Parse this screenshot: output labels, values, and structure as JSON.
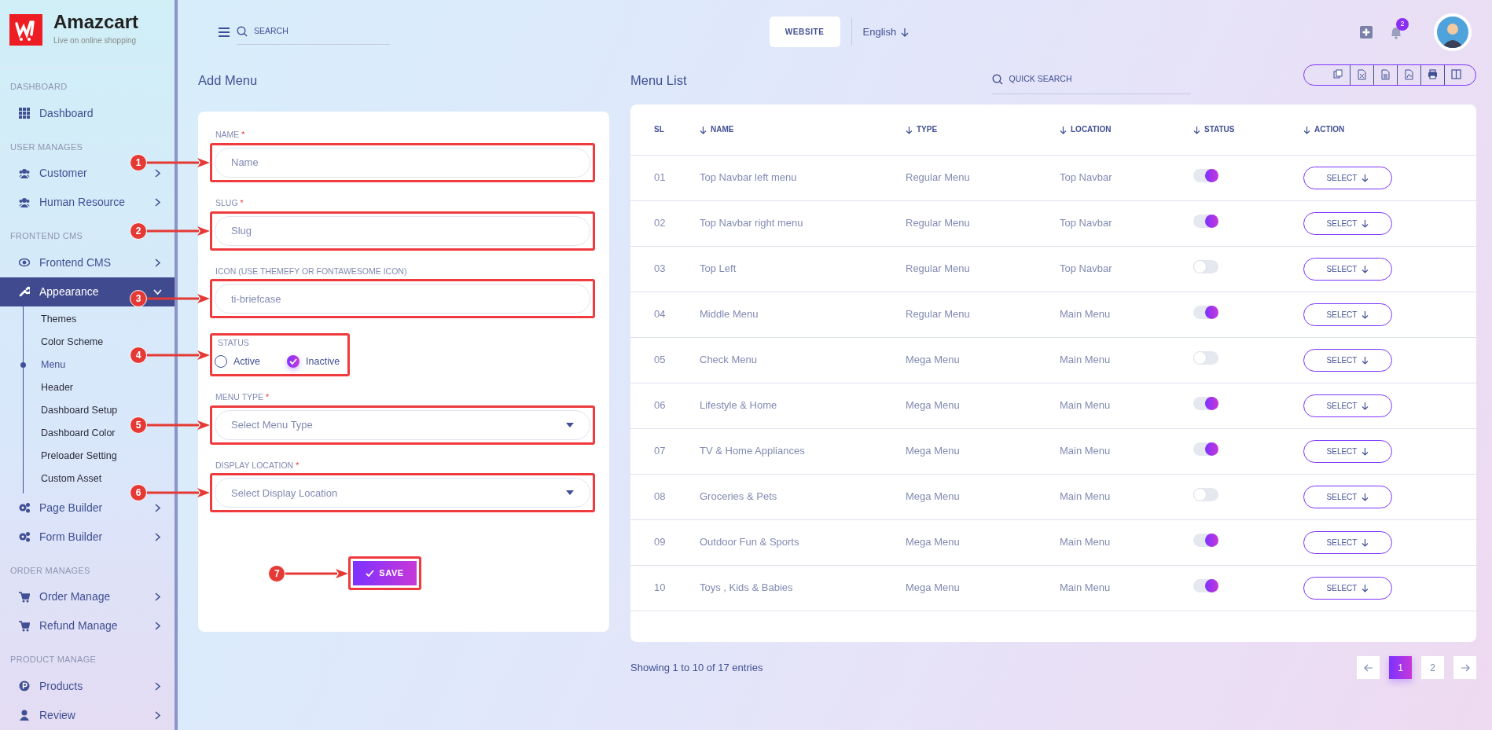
{
  "brand": {
    "name": "Amazcart",
    "tagline": "Live on online shopping"
  },
  "sidebar": [
    {
      "heading": "DASHBOARD",
      "items": [
        {
          "label": "Dashboard",
          "selected": false
        }
      ]
    },
    {
      "heading": "USER MANAGES",
      "items": [
        {
          "label": "Customer",
          "expanded": false,
          "selected": false
        },
        {
          "label": "Human Resource",
          "expanded": false,
          "selected": false
        }
      ]
    },
    {
      "heading": "FRONTEND CMS",
      "items": [
        {
          "label": "Frontend CMS",
          "expanded": false,
          "selected": false
        },
        {
          "label": "Appearance",
          "expanded": true,
          "selected": true,
          "children": [
            {
              "label": "Themes",
              "selected": false
            },
            {
              "label": "Color Scheme",
              "selected": false
            },
            {
              "label": "Menu",
              "selected": true
            },
            {
              "label": "Header",
              "selected": false
            },
            {
              "label": "Dashboard Setup",
              "selected": false
            },
            {
              "label": "Dashboard Color",
              "selected": false
            },
            {
              "label": "Preloader Setting",
              "selected": false
            },
            {
              "label": "Custom Asset",
              "selected": false
            }
          ]
        },
        {
          "label": "Page Builder",
          "expanded": false,
          "selected": false
        },
        {
          "label": "Form Builder",
          "expanded": false,
          "selected": false
        }
      ]
    },
    {
      "heading": "ORDER MANAGES",
      "items": [
        {
          "label": "Order Manage",
          "expanded": false,
          "selected": false
        },
        {
          "label": "Refund Manage",
          "expanded": false,
          "selected": false
        }
      ]
    },
    {
      "heading": "PRODUCT MANAGE",
      "items": [
        {
          "label": "Products",
          "expanded": false,
          "selected": false
        },
        {
          "label": "Review",
          "expanded": false,
          "selected": false
        }
      ]
    }
  ],
  "topbar": {
    "search_placeholder": "SEARCH",
    "website_button": "WEBSITE",
    "language": "English",
    "notification_count": "2"
  },
  "add_menu": {
    "title": "Add Menu",
    "fields": [
      {
        "kind": "text",
        "label": "NAME",
        "required_mark": "*",
        "placeholder": "Name",
        "highlighted": true,
        "callout": "1"
      },
      {
        "kind": "text",
        "label": "SLUG",
        "required_mark": "*",
        "placeholder": "Slug",
        "highlighted": true,
        "callout": "2"
      },
      {
        "kind": "text",
        "label": "ICON (USE THEMEFY OR FONTAWESOME ICON)",
        "placeholder": "ti-briefcase",
        "highlighted": true,
        "callout": "3"
      },
      {
        "kind": "radio",
        "label": "STATUS",
        "options": [
          {
            "label": "Active",
            "selected": false
          },
          {
            "label": "Inactive",
            "selected": true
          }
        ],
        "highlighted": true,
        "callout": "4"
      },
      {
        "kind": "select",
        "label": "MENU TYPE",
        "required_mark": "*",
        "placeholder": "Select Menu Type",
        "highlighted": true,
        "callout": "5"
      },
      {
        "kind": "select",
        "label": "DISPLAY LOCATION",
        "required_mark": "*",
        "placeholder": "Select Display Location",
        "highlighted": true,
        "callout": "6"
      }
    ],
    "save": {
      "label": "SAVE",
      "highlighted": true,
      "callout": "7"
    }
  },
  "menu_list": {
    "title": "Menu List",
    "quick_search_placeholder": "QUICK SEARCH",
    "columns": [
      {
        "label": "SL",
        "sortable": false
      },
      {
        "label": "NAME",
        "sortable": true
      },
      {
        "label": "TYPE",
        "sortable": true
      },
      {
        "label": "LOCATION",
        "sortable": true
      },
      {
        "label": "STATUS",
        "sortable": true
      },
      {
        "label": "ACTION",
        "sortable": true
      }
    ],
    "rows": [
      {
        "sl": "01",
        "name": "Top Navbar left menu",
        "type": "Regular Menu",
        "location": "Top Navbar",
        "active": true,
        "action": "SELECT"
      },
      {
        "sl": "02",
        "name": "Top Navbar right menu",
        "type": "Regular Menu",
        "location": "Top Navbar",
        "active": true,
        "action": "SELECT"
      },
      {
        "sl": "03",
        "name": "Top Left",
        "type": "Regular Menu",
        "location": "Top Navbar",
        "active": false,
        "action": "SELECT"
      },
      {
        "sl": "04",
        "name": "Middle Menu",
        "type": "Regular Menu",
        "location": "Main Menu",
        "active": true,
        "action": "SELECT"
      },
      {
        "sl": "05",
        "name": "Check Menu",
        "type": "Mega Menu",
        "location": "Main Menu",
        "active": false,
        "action": "SELECT"
      },
      {
        "sl": "06",
        "name": "Lifestyle & Home",
        "type": "Mega Menu",
        "location": "Main Menu",
        "active": true,
        "action": "SELECT"
      },
      {
        "sl": "07",
        "name": "TV & Home Appliances",
        "type": "Mega Menu",
        "location": "Main Menu",
        "active": true,
        "action": "SELECT"
      },
      {
        "sl": "08",
        "name": "Groceries & Pets",
        "type": "Mega Menu",
        "location": "Main Menu",
        "active": false,
        "action": "SELECT"
      },
      {
        "sl": "09",
        "name": "Outdoor Fun & Sports",
        "type": "Mega Menu",
        "location": "Main Menu",
        "active": true,
        "action": "SELECT"
      },
      {
        "sl": "10",
        "name": "Toys , Kids & Babies",
        "type": "Mega Menu",
        "location": "Main Menu",
        "active": true,
        "action": "SELECT"
      }
    ],
    "summary": "Showing 1 to 10 of 17 entries",
    "pages": [
      {
        "label": "1",
        "selected": true
      },
      {
        "label": "2",
        "selected": false
      }
    ]
  }
}
